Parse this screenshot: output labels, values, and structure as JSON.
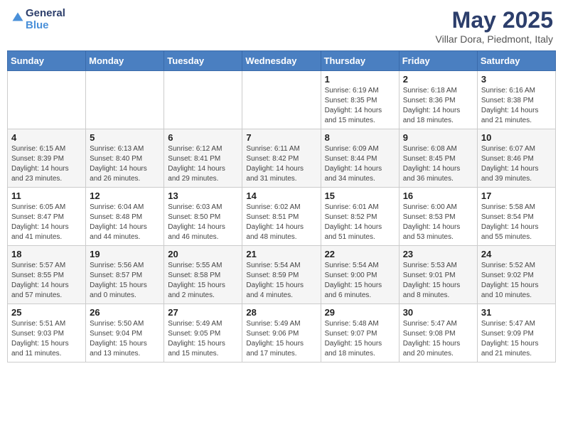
{
  "header": {
    "logo_line1": "General",
    "logo_line2": "Blue",
    "month_title": "May 2025",
    "location": "Villar Dora, Piedmont, Italy"
  },
  "days_of_week": [
    "Sunday",
    "Monday",
    "Tuesday",
    "Wednesday",
    "Thursday",
    "Friday",
    "Saturday"
  ],
  "weeks": [
    [
      {
        "day": "",
        "info": ""
      },
      {
        "day": "",
        "info": ""
      },
      {
        "day": "",
        "info": ""
      },
      {
        "day": "",
        "info": ""
      },
      {
        "day": "1",
        "info": "Sunrise: 6:19 AM\nSunset: 8:35 PM\nDaylight: 14 hours\nand 15 minutes."
      },
      {
        "day": "2",
        "info": "Sunrise: 6:18 AM\nSunset: 8:36 PM\nDaylight: 14 hours\nand 18 minutes."
      },
      {
        "day": "3",
        "info": "Sunrise: 6:16 AM\nSunset: 8:38 PM\nDaylight: 14 hours\nand 21 minutes."
      }
    ],
    [
      {
        "day": "4",
        "info": "Sunrise: 6:15 AM\nSunset: 8:39 PM\nDaylight: 14 hours\nand 23 minutes."
      },
      {
        "day": "5",
        "info": "Sunrise: 6:13 AM\nSunset: 8:40 PM\nDaylight: 14 hours\nand 26 minutes."
      },
      {
        "day": "6",
        "info": "Sunrise: 6:12 AM\nSunset: 8:41 PM\nDaylight: 14 hours\nand 29 minutes."
      },
      {
        "day": "7",
        "info": "Sunrise: 6:11 AM\nSunset: 8:42 PM\nDaylight: 14 hours\nand 31 minutes."
      },
      {
        "day": "8",
        "info": "Sunrise: 6:09 AM\nSunset: 8:44 PM\nDaylight: 14 hours\nand 34 minutes."
      },
      {
        "day": "9",
        "info": "Sunrise: 6:08 AM\nSunset: 8:45 PM\nDaylight: 14 hours\nand 36 minutes."
      },
      {
        "day": "10",
        "info": "Sunrise: 6:07 AM\nSunset: 8:46 PM\nDaylight: 14 hours\nand 39 minutes."
      }
    ],
    [
      {
        "day": "11",
        "info": "Sunrise: 6:05 AM\nSunset: 8:47 PM\nDaylight: 14 hours\nand 41 minutes."
      },
      {
        "day": "12",
        "info": "Sunrise: 6:04 AM\nSunset: 8:48 PM\nDaylight: 14 hours\nand 44 minutes."
      },
      {
        "day": "13",
        "info": "Sunrise: 6:03 AM\nSunset: 8:50 PM\nDaylight: 14 hours\nand 46 minutes."
      },
      {
        "day": "14",
        "info": "Sunrise: 6:02 AM\nSunset: 8:51 PM\nDaylight: 14 hours\nand 48 minutes."
      },
      {
        "day": "15",
        "info": "Sunrise: 6:01 AM\nSunset: 8:52 PM\nDaylight: 14 hours\nand 51 minutes."
      },
      {
        "day": "16",
        "info": "Sunrise: 6:00 AM\nSunset: 8:53 PM\nDaylight: 14 hours\nand 53 minutes."
      },
      {
        "day": "17",
        "info": "Sunrise: 5:58 AM\nSunset: 8:54 PM\nDaylight: 14 hours\nand 55 minutes."
      }
    ],
    [
      {
        "day": "18",
        "info": "Sunrise: 5:57 AM\nSunset: 8:55 PM\nDaylight: 14 hours\nand 57 minutes."
      },
      {
        "day": "19",
        "info": "Sunrise: 5:56 AM\nSunset: 8:57 PM\nDaylight: 15 hours\nand 0 minutes."
      },
      {
        "day": "20",
        "info": "Sunrise: 5:55 AM\nSunset: 8:58 PM\nDaylight: 15 hours\nand 2 minutes."
      },
      {
        "day": "21",
        "info": "Sunrise: 5:54 AM\nSunset: 8:59 PM\nDaylight: 15 hours\nand 4 minutes."
      },
      {
        "day": "22",
        "info": "Sunrise: 5:54 AM\nSunset: 9:00 PM\nDaylight: 15 hours\nand 6 minutes."
      },
      {
        "day": "23",
        "info": "Sunrise: 5:53 AM\nSunset: 9:01 PM\nDaylight: 15 hours\nand 8 minutes."
      },
      {
        "day": "24",
        "info": "Sunrise: 5:52 AM\nSunset: 9:02 PM\nDaylight: 15 hours\nand 10 minutes."
      }
    ],
    [
      {
        "day": "25",
        "info": "Sunrise: 5:51 AM\nSunset: 9:03 PM\nDaylight: 15 hours\nand 11 minutes."
      },
      {
        "day": "26",
        "info": "Sunrise: 5:50 AM\nSunset: 9:04 PM\nDaylight: 15 hours\nand 13 minutes."
      },
      {
        "day": "27",
        "info": "Sunrise: 5:49 AM\nSunset: 9:05 PM\nDaylight: 15 hours\nand 15 minutes."
      },
      {
        "day": "28",
        "info": "Sunrise: 5:49 AM\nSunset: 9:06 PM\nDaylight: 15 hours\nand 17 minutes."
      },
      {
        "day": "29",
        "info": "Sunrise: 5:48 AM\nSunset: 9:07 PM\nDaylight: 15 hours\nand 18 minutes."
      },
      {
        "day": "30",
        "info": "Sunrise: 5:47 AM\nSunset: 9:08 PM\nDaylight: 15 hours\nand 20 minutes."
      },
      {
        "day": "31",
        "info": "Sunrise: 5:47 AM\nSunset: 9:09 PM\nDaylight: 15 hours\nand 21 minutes."
      }
    ]
  ]
}
